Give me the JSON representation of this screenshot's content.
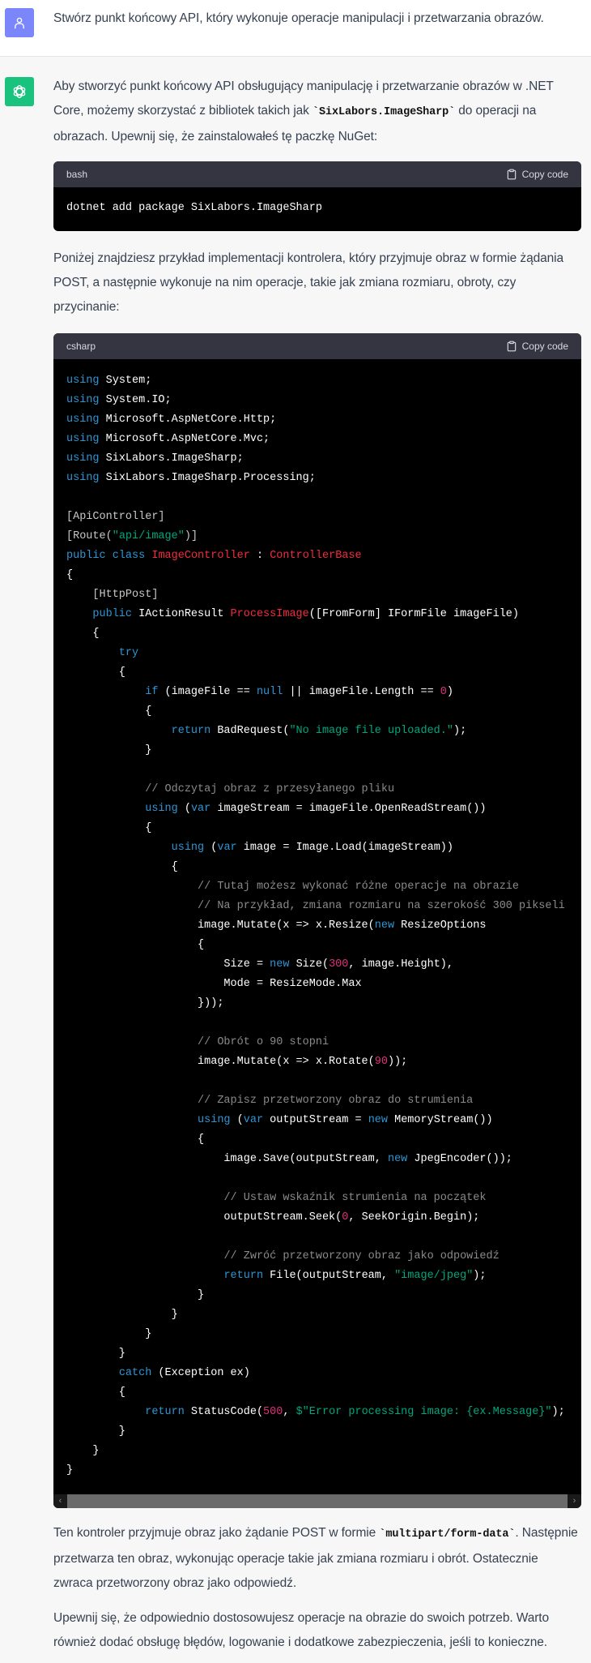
{
  "user_message": {
    "avatar_icon": "user-icon",
    "text": "Stwórz punkt końcowy API, który wykonuje operacje manipulacji i przetwarzania obrazów."
  },
  "assistant_message": {
    "avatar_icon": "openai-logo-icon",
    "intro": {
      "before": "Aby stworzyć punkt końcowy API obsługujący manipulację i przetwarzanie obrazów w .NET Core, możemy skorzystać z bibliotek takich jak ",
      "code": "`SixLabors.ImageSharp`",
      "after": " do operacji na obrazach. Upewnij się, że zainstalowałeś tę paczkę NuGet:"
    },
    "bash_block": {
      "language": "bash",
      "copy_label": "Copy code",
      "code": "dotnet add package SixLabors.ImageSharp"
    },
    "middle_paragraph": "Poniżej znajdziesz przykład implementacji kontrolera, który przyjmuje obraz w formie żądania POST, a następnie wykonuje na nim operacje, takie jak zmiana rozmiaru, obroty, czy przycinanie:",
    "csharp_block": {
      "language": "csharp",
      "copy_label": "Copy code",
      "lines": [
        [
          [
            "kw",
            "using"
          ],
          [
            "t",
            " System;"
          ]
        ],
        [
          [
            "kw",
            "using"
          ],
          [
            "t",
            " System.IO;"
          ]
        ],
        [
          [
            "kw",
            "using"
          ],
          [
            "t",
            " Microsoft.AspNetCore.Http;"
          ]
        ],
        [
          [
            "kw",
            "using"
          ],
          [
            "t",
            " Microsoft.AspNetCore.Mvc;"
          ]
        ],
        [
          [
            "kw",
            "using"
          ],
          [
            "t",
            " SixLabors.ImageSharp;"
          ]
        ],
        [
          [
            "kw",
            "using"
          ],
          [
            "t",
            " SixLabors.ImageSharp.Processing;"
          ]
        ],
        [],
        [
          [
            "attr",
            "[ApiController]"
          ]
        ],
        [
          [
            "attr",
            "[Route("
          ],
          [
            "str",
            "\"api/image\""
          ],
          [
            "attr",
            ")]"
          ]
        ],
        [
          [
            "kw",
            "public"
          ],
          [
            "t",
            " "
          ],
          [
            "kw",
            "class"
          ],
          [
            "t",
            " "
          ],
          [
            "cls",
            "ImageController"
          ],
          [
            "t",
            " : "
          ],
          [
            "cls",
            "ControllerBase"
          ]
        ],
        [
          [
            "t",
            "{"
          ]
        ],
        [
          [
            "t",
            "    "
          ],
          [
            "attr",
            "[HttpPost]"
          ]
        ],
        [
          [
            "t",
            "    "
          ],
          [
            "kw",
            "public"
          ],
          [
            "t",
            " IActionResult "
          ],
          [
            "cls",
            "ProcessImage"
          ],
          [
            "t",
            "([FromForm] IFormFile imageFile)"
          ]
        ],
        [
          [
            "t",
            "    {"
          ]
        ],
        [
          [
            "t",
            "        "
          ],
          [
            "kw",
            "try"
          ]
        ],
        [
          [
            "t",
            "        {"
          ]
        ],
        [
          [
            "t",
            "            "
          ],
          [
            "kw",
            "if"
          ],
          [
            "t",
            " (imageFile == "
          ],
          [
            "kw",
            "null"
          ],
          [
            "t",
            " || imageFile.Length == "
          ],
          [
            "num",
            "0"
          ],
          [
            "t",
            ")"
          ]
        ],
        [
          [
            "t",
            "            {"
          ]
        ],
        [
          [
            "t",
            "                "
          ],
          [
            "kw",
            "return"
          ],
          [
            "t",
            " BadRequest("
          ],
          [
            "str",
            "\"No image file uploaded.\""
          ],
          [
            "t",
            ");"
          ]
        ],
        [
          [
            "t",
            "            }"
          ]
        ],
        [],
        [
          [
            "t",
            "            "
          ],
          [
            "cm",
            "// Odczytaj obraz z przesyłanego pliku"
          ]
        ],
        [
          [
            "t",
            "            "
          ],
          [
            "kw",
            "using"
          ],
          [
            "t",
            " ("
          ],
          [
            "kw",
            "var"
          ],
          [
            "t",
            " imageStream = imageFile.OpenReadStream())"
          ]
        ],
        [
          [
            "t",
            "            {"
          ]
        ],
        [
          [
            "t",
            "                "
          ],
          [
            "kw",
            "using"
          ],
          [
            "t",
            " ("
          ],
          [
            "kw",
            "var"
          ],
          [
            "t",
            " image = Image.Load(imageStream))"
          ]
        ],
        [
          [
            "t",
            "                {"
          ]
        ],
        [
          [
            "t",
            "                    "
          ],
          [
            "cm",
            "// Tutaj możesz wykonać różne operacje na obrazie"
          ]
        ],
        [
          [
            "t",
            "                    "
          ],
          [
            "cm",
            "// Na przykład, zmiana rozmiaru na szerokość 300 pikseli"
          ]
        ],
        [
          [
            "t",
            "                    image.Mutate(x => x.Resize("
          ],
          [
            "kw",
            "new"
          ],
          [
            "t",
            " ResizeOptions"
          ]
        ],
        [
          [
            "t",
            "                    {"
          ]
        ],
        [
          [
            "t",
            "                        Size = "
          ],
          [
            "kw",
            "new"
          ],
          [
            "t",
            " Size("
          ],
          [
            "num",
            "300"
          ],
          [
            "t",
            ", image.Height),"
          ]
        ],
        [
          [
            "t",
            "                        Mode = ResizeMode.Max"
          ]
        ],
        [
          [
            "t",
            "                    }));"
          ]
        ],
        [],
        [
          [
            "t",
            "                    "
          ],
          [
            "cm",
            "// Obrót o 90 stopni"
          ]
        ],
        [
          [
            "t",
            "                    image.Mutate(x => x.Rotate("
          ],
          [
            "num",
            "90"
          ],
          [
            "t",
            "));"
          ]
        ],
        [],
        [
          [
            "t",
            "                    "
          ],
          [
            "cm",
            "// Zapisz przetworzony obraz do strumienia"
          ]
        ],
        [
          [
            "t",
            "                    "
          ],
          [
            "kw",
            "using"
          ],
          [
            "t",
            " ("
          ],
          [
            "kw",
            "var"
          ],
          [
            "t",
            " outputStream = "
          ],
          [
            "kw",
            "new"
          ],
          [
            "t",
            " MemoryStream())"
          ]
        ],
        [
          [
            "t",
            "                    {"
          ]
        ],
        [
          [
            "t",
            "                        image.Save(outputStream, "
          ],
          [
            "kw",
            "new"
          ],
          [
            "t",
            " JpegEncoder());"
          ]
        ],
        [],
        [
          [
            "t",
            "                        "
          ],
          [
            "cm",
            "// Ustaw wskaźnik strumienia na początek"
          ]
        ],
        [
          [
            "t",
            "                        outputStream.Seek("
          ],
          [
            "num",
            "0"
          ],
          [
            "t",
            ", SeekOrigin.Begin);"
          ]
        ],
        [],
        [
          [
            "t",
            "                        "
          ],
          [
            "cm",
            "// Zwróć przetworzony obraz jako odpowiedź"
          ]
        ],
        [
          [
            "t",
            "                        "
          ],
          [
            "kw",
            "return"
          ],
          [
            "t",
            " File(outputStream, "
          ],
          [
            "str",
            "\"image/jpeg\""
          ],
          [
            "t",
            ");"
          ]
        ],
        [
          [
            "t",
            "                    }"
          ]
        ],
        [
          [
            "t",
            "                }"
          ]
        ],
        [
          [
            "t",
            "            }"
          ]
        ],
        [
          [
            "t",
            "        }"
          ]
        ],
        [
          [
            "t",
            "        "
          ],
          [
            "kw",
            "catch"
          ],
          [
            "t",
            " (Exception ex)"
          ]
        ],
        [
          [
            "t",
            "        {"
          ]
        ],
        [
          [
            "t",
            "            "
          ],
          [
            "kw",
            "return"
          ],
          [
            "t",
            " StatusCode("
          ],
          [
            "num",
            "500"
          ],
          [
            "t",
            ", "
          ],
          [
            "str",
            "$\"Error processing image: {ex.Message}\""
          ],
          [
            "t",
            ");"
          ]
        ],
        [
          [
            "t",
            "        }"
          ]
        ],
        [
          [
            "t",
            "    }"
          ]
        ],
        [
          [
            "t",
            "}"
          ]
        ]
      ]
    },
    "outro_1": {
      "before": "Ten kontroler przyjmuje obraz jako żądanie POST w formie ",
      "code": "`multipart/form-data`",
      "after": ". Następnie przetwarza ten obraz, wykonując operacje takie jak zmiana rozmiaru i obrót. Ostatecznie zwraca przetworzony obraz jako odpowiedź."
    },
    "outro_2": "Upewnij się, że odpowiednio dostosowujesz operacje na obrazie do swoich potrzeb. Warto również dodać obsługę błędów, logowanie i dodatkowe zabezpieczenia, jeśli to konieczne."
  },
  "colors": {
    "user_avatar": "#7c86fb",
    "assistant_avatar": "#19c37d",
    "keyword": "#2e95d3",
    "class_name": "#f22c3d",
    "string": "#00a67d",
    "number": "#df3079",
    "comment": "#8a8a8a"
  },
  "scrollbar": {
    "left_arrow": "‹",
    "right_arrow": "›"
  }
}
